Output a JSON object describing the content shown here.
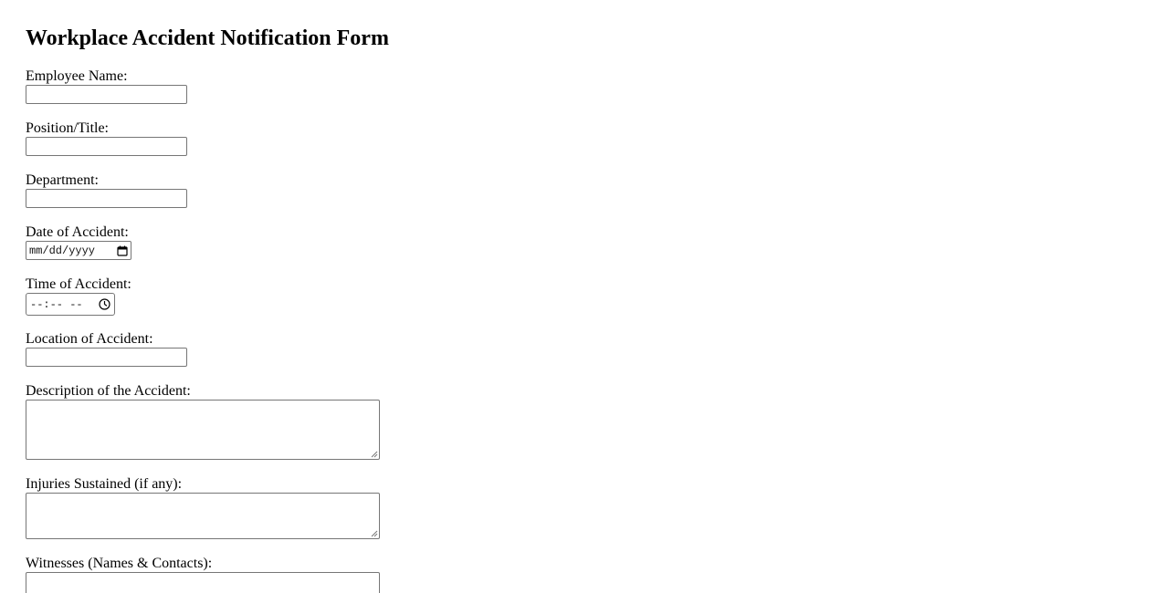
{
  "form": {
    "title": "Workplace Accident Notification Form",
    "fields": {
      "employee_name": {
        "label": "Employee Name:",
        "value": ""
      },
      "position_title": {
        "label": "Position/Title:",
        "value": ""
      },
      "department": {
        "label": "Department:",
        "value": ""
      },
      "date_of_accident": {
        "label": "Date of Accident:",
        "placeholder": "mm/dd/yyyy",
        "icon": "calendar-icon"
      },
      "time_of_accident": {
        "label": "Time of Accident:",
        "placeholder": "--:-- --",
        "icon": "clock-icon"
      },
      "location_of_accident": {
        "label": "Location of Accident:",
        "value": ""
      },
      "description": {
        "label": "Description of the Accident:",
        "value": ""
      },
      "injuries": {
        "label": "Injuries Sustained (if any):",
        "value": ""
      },
      "witnesses": {
        "label": "Witnesses (Names & Contacts):",
        "value": ""
      }
    }
  }
}
